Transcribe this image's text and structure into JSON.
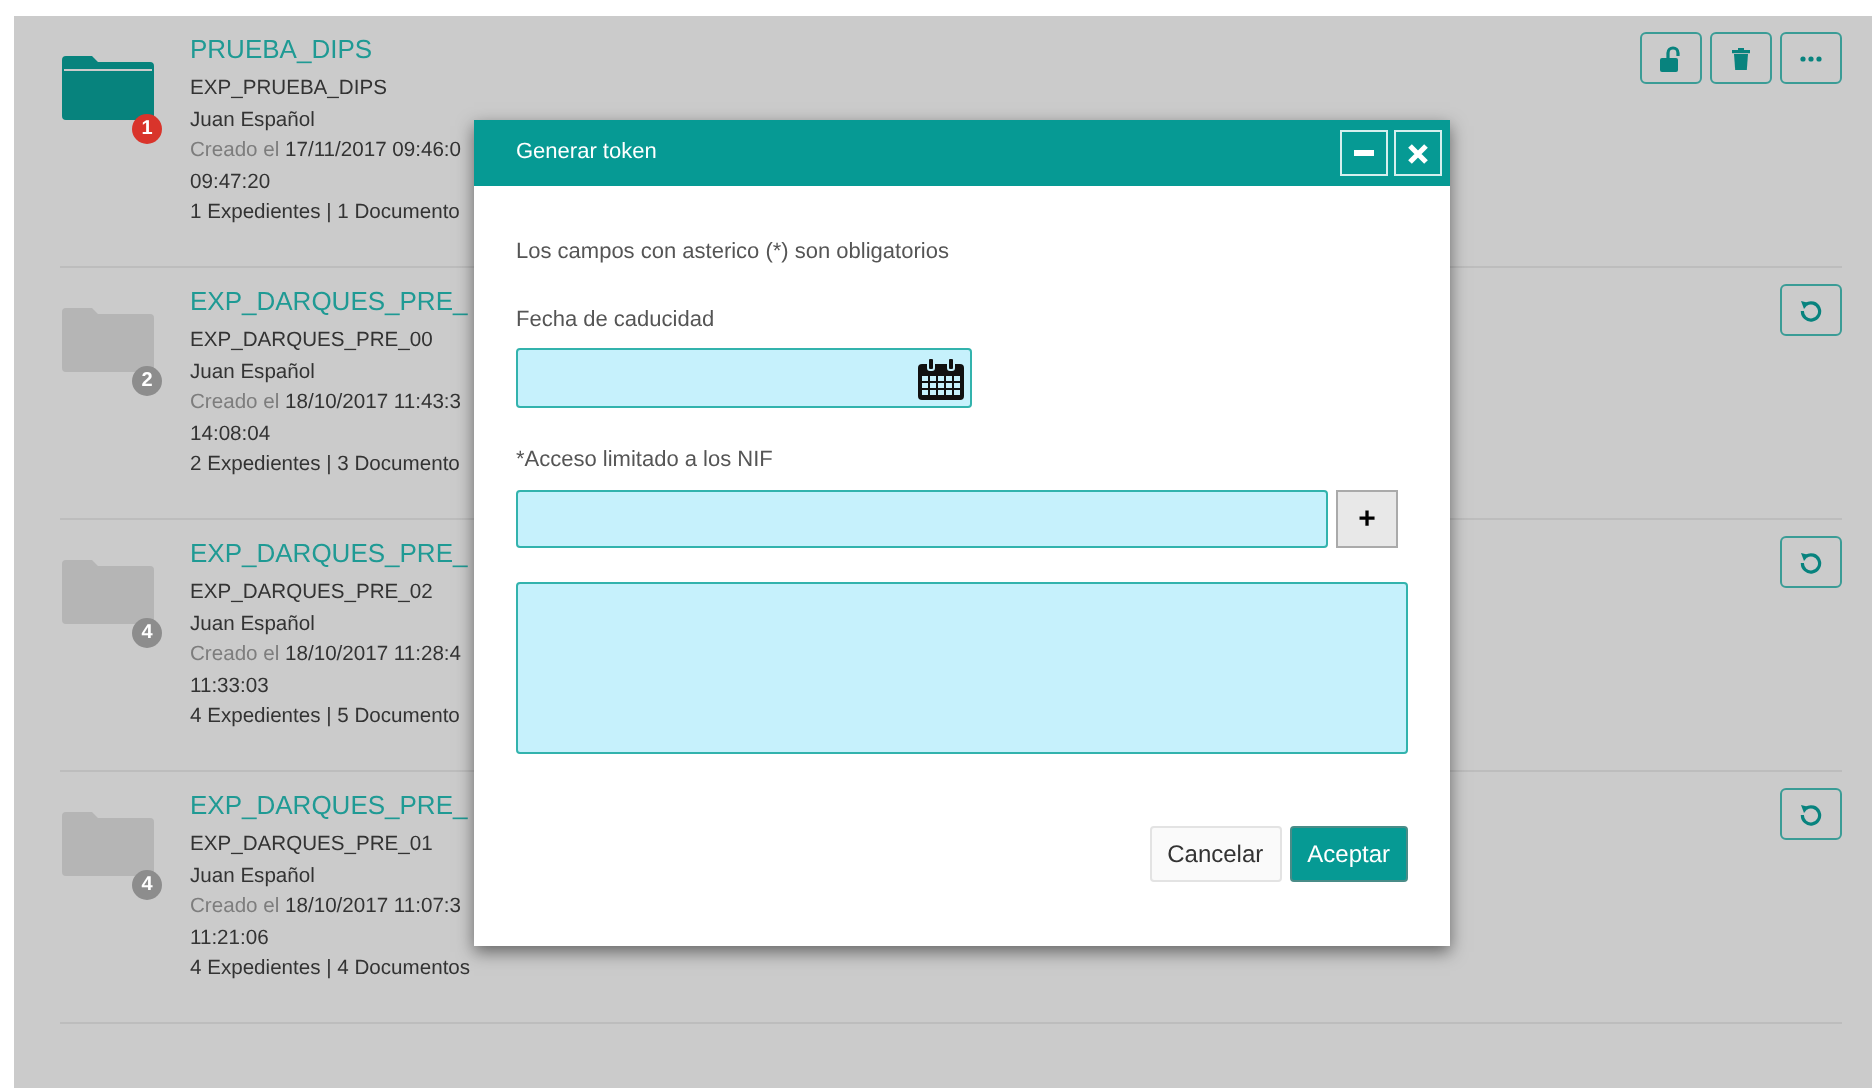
{
  "items": [
    {
      "title": "PRUEBA_DIPS",
      "selected": true,
      "count": "1",
      "code": "EXP_PRUEBA_DIPS",
      "author": "Juan Español",
      "created_label": "Creado el",
      "created_value": "17/11/2017 09:46:0",
      "modified": "09:47:20",
      "totals": "1 Expedientes | 1 Documento",
      "actions": [
        {
          "kind": "unlock"
        },
        {
          "kind": "delete"
        },
        {
          "kind": "more"
        }
      ]
    },
    {
      "title": "EXP_DARQUES_PRE_",
      "selected": false,
      "count": "2",
      "code": "EXP_DARQUES_PRE_00",
      "author": "Juan Español",
      "created_label": "Creado el",
      "created_value": "18/10/2017 11:43:3",
      "modified": "14:08:04",
      "totals": "2 Expedientes | 3 Documento",
      "actions": [
        {
          "kind": "restore"
        }
      ]
    },
    {
      "title": "EXP_DARQUES_PRE_",
      "selected": false,
      "count": "4",
      "code": "EXP_DARQUES_PRE_02",
      "author": "Juan Español",
      "created_label": "Creado el",
      "created_value": "18/10/2017 11:28:4",
      "modified": "11:33:03",
      "totals": "4 Expedientes | 5 Documento",
      "actions": [
        {
          "kind": "restore"
        }
      ]
    },
    {
      "title": "EXP_DARQUES_PRE_",
      "selected": false,
      "count": "4",
      "code": "EXP_DARQUES_PRE_01",
      "author": "Juan Español",
      "created_label": "Creado el",
      "created_value": "18/10/2017 11:07:3",
      "modified": "11:21:06",
      "totals": "4 Expedientes | 4 Documentos",
      "actions": [
        {
          "kind": "restore"
        }
      ]
    }
  ],
  "dialog": {
    "title": "Generar token",
    "note": "Los campos con asterico (*) son obligatorios",
    "date_field": {
      "label": "Fecha de caducidad"
    },
    "nif_field": {
      "label": "*Acceso limitado a los NIF",
      "add_button": "+"
    },
    "buttons": [
      {
        "label": "Cancelar",
        "kind": "secondary"
      },
      {
        "label": "Aceptar",
        "kind": "primary"
      }
    ]
  }
}
